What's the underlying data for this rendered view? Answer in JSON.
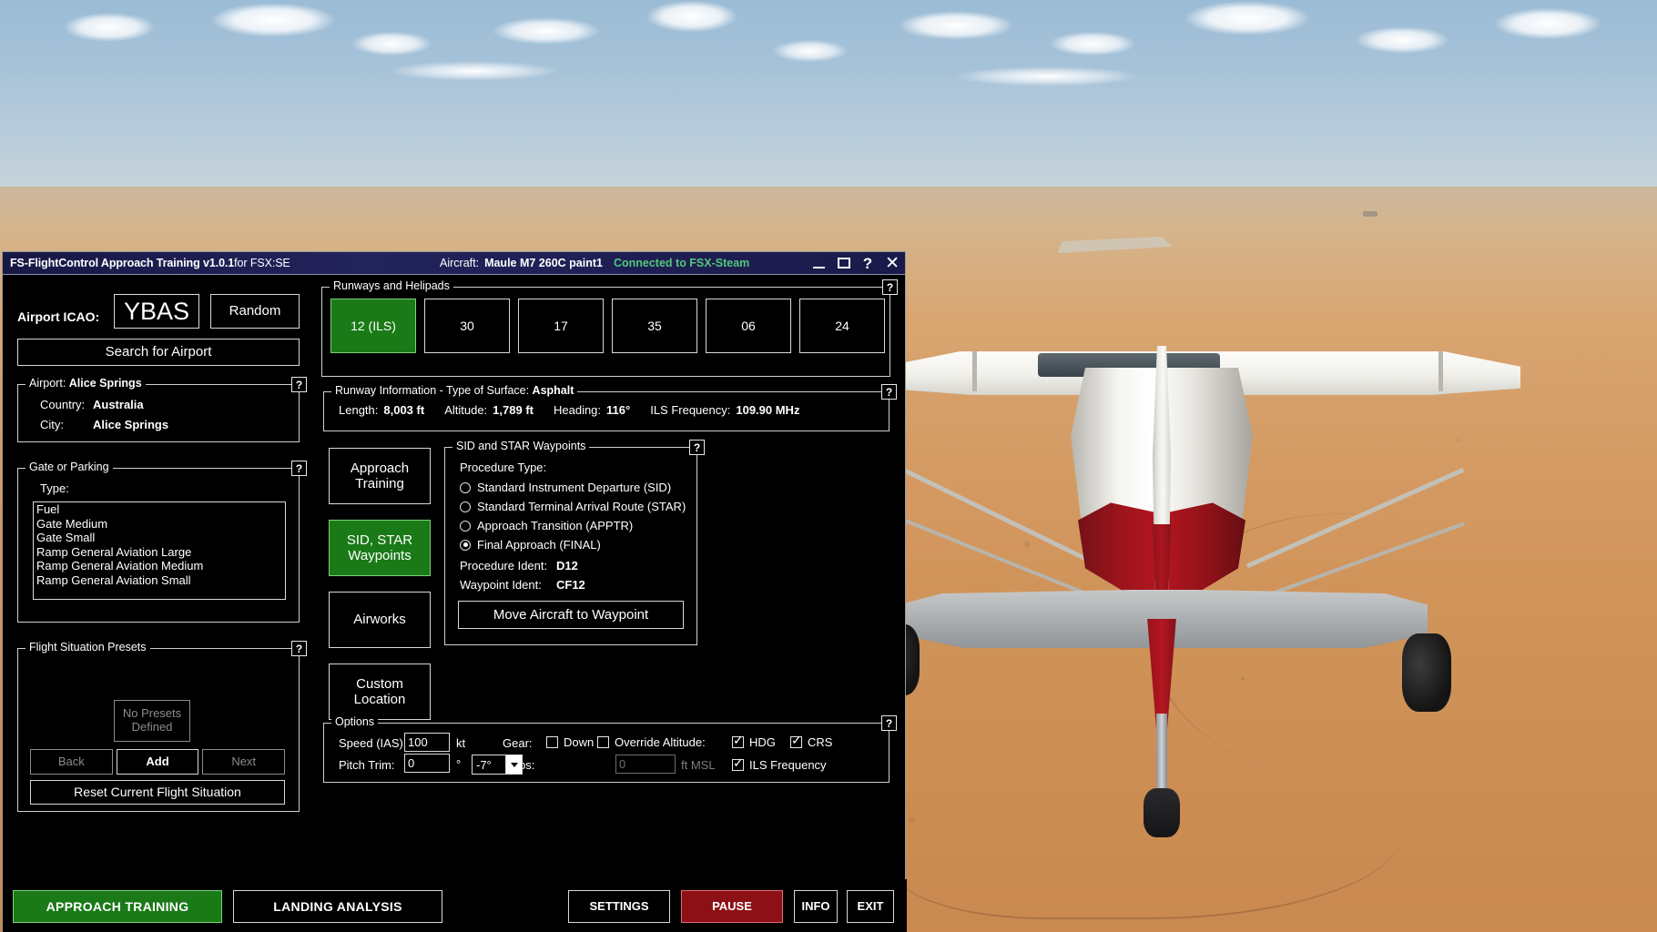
{
  "window": {
    "title_main": "FS-FlightControl Approach Training ",
    "title_version": "v1.0.1",
    "title_suffix": "for FSX:SE",
    "aircraft_label": "Aircraft:",
    "aircraft_value": "Maule M7 260C paint1",
    "connection_status": "Connected to FSX-Steam",
    "controls": {
      "minimize": "minimize-icon",
      "maximize": "maximize-icon",
      "help": "?",
      "close": "✕"
    }
  },
  "airport_search": {
    "icao_label": "Airport ICAO:",
    "icao_value": "YBAS",
    "random_label": "Random",
    "search_label": "Search for Airport"
  },
  "airport_info": {
    "legend_prefix": "Airport: ",
    "legend_value": "Alice Springs",
    "country_label": "Country:",
    "country_value": "Australia",
    "city_label": "City:",
    "city_value": "Alice Springs",
    "help": "?"
  },
  "gate_or_parking": {
    "legend": "Gate or Parking",
    "type_label": "Type:",
    "help": "?",
    "items": [
      "Fuel",
      "Gate Medium",
      "Gate Small",
      "Ramp General Aviation Large",
      "Ramp General Aviation Medium",
      "Ramp General Aviation Small"
    ]
  },
  "flight_situation_presets": {
    "legend": "Flight Situation Presets",
    "help": "?",
    "empty_line1": "No Presets",
    "empty_line2": "Defined",
    "back_label": "Back",
    "add_label": "Add",
    "next_label": "Next",
    "reset_label": "Reset Current Flight Situation"
  },
  "runways": {
    "legend": "Runways and Helipads",
    "help": "?",
    "items": [
      {
        "label": "12 (ILS)",
        "selected": true
      },
      {
        "label": "30",
        "selected": false
      },
      {
        "label": "17",
        "selected": false
      },
      {
        "label": "35",
        "selected": false
      },
      {
        "label": "06",
        "selected": false
      },
      {
        "label": "24",
        "selected": false
      }
    ]
  },
  "runway_information": {
    "legend_prefix": "Runway Information - Type of Surface: ",
    "surface": "Asphalt",
    "help": "?",
    "length_label": "Length:",
    "length_value": "8,003 ft",
    "altitude_label": "Altitude:",
    "altitude_value": "1,789 ft",
    "heading_label": "Heading:",
    "heading_value": "116°",
    "ils_label": "ILS Frequency:",
    "ils_value": "109.90 MHz"
  },
  "mode_buttons": [
    {
      "line1": "Approach",
      "line2": "Training",
      "selected": false
    },
    {
      "line1": "SID, STAR",
      "line2": "Waypoints",
      "selected": true
    },
    {
      "line1": "Airworks",
      "line2": "",
      "selected": false
    },
    {
      "line1": "Custom",
      "line2": "Location",
      "selected": false
    }
  ],
  "sid_star": {
    "legend": "SID and STAR Waypoints",
    "help": "?",
    "procedure_type_label": "Procedure Type:",
    "options": [
      {
        "label": "Standard Instrument Departure (SID)",
        "selected": false
      },
      {
        "label": "Standard Terminal Arrival Route (STAR)",
        "selected": false
      },
      {
        "label": "Approach Transition (APPTR)",
        "selected": false
      },
      {
        "label": "Final Approach (FINAL)",
        "selected": true
      }
    ],
    "procedure_ident_label": "Procedure Ident:",
    "procedure_ident_value": "D12",
    "waypoint_ident_label": "Waypoint Ident:",
    "waypoint_ident_value": "CF12",
    "move_button": "Move Aircraft to Waypoint"
  },
  "options": {
    "legend": "Options",
    "help": "?",
    "speed_label": "Speed (IAS):",
    "speed_value": "100",
    "speed_unit": "kt",
    "pitch_label": "Pitch Trim:",
    "pitch_value": "0",
    "pitch_unit": "°",
    "gear_label": "Gear:",
    "gear_down_label": "Down",
    "gear_down_checked": false,
    "flaps_label": "Flaps:",
    "flaps_value": "-7°",
    "override_altitude_label": "Override Altitude:",
    "override_altitude_checked": false,
    "altitude_value": "0",
    "altitude_unit": "ft MSL",
    "hdg_label": "HDG",
    "hdg_checked": true,
    "crs_label": "CRS",
    "crs_checked": true,
    "ils_label": "ILS Frequency",
    "ils_checked": true
  },
  "footer": {
    "approach_training": "APPROACH TRAINING",
    "landing_analysis": "LANDING ANALYSIS",
    "settings": "SETTINGS",
    "pause": "PAUSE",
    "info": "INFO",
    "exit": "EXIT"
  },
  "colors": {
    "accent_green": "#1a7a17",
    "pause_red": "#8d1017",
    "title_blue": "#1a1a4a",
    "connected_green": "#53c77a"
  }
}
